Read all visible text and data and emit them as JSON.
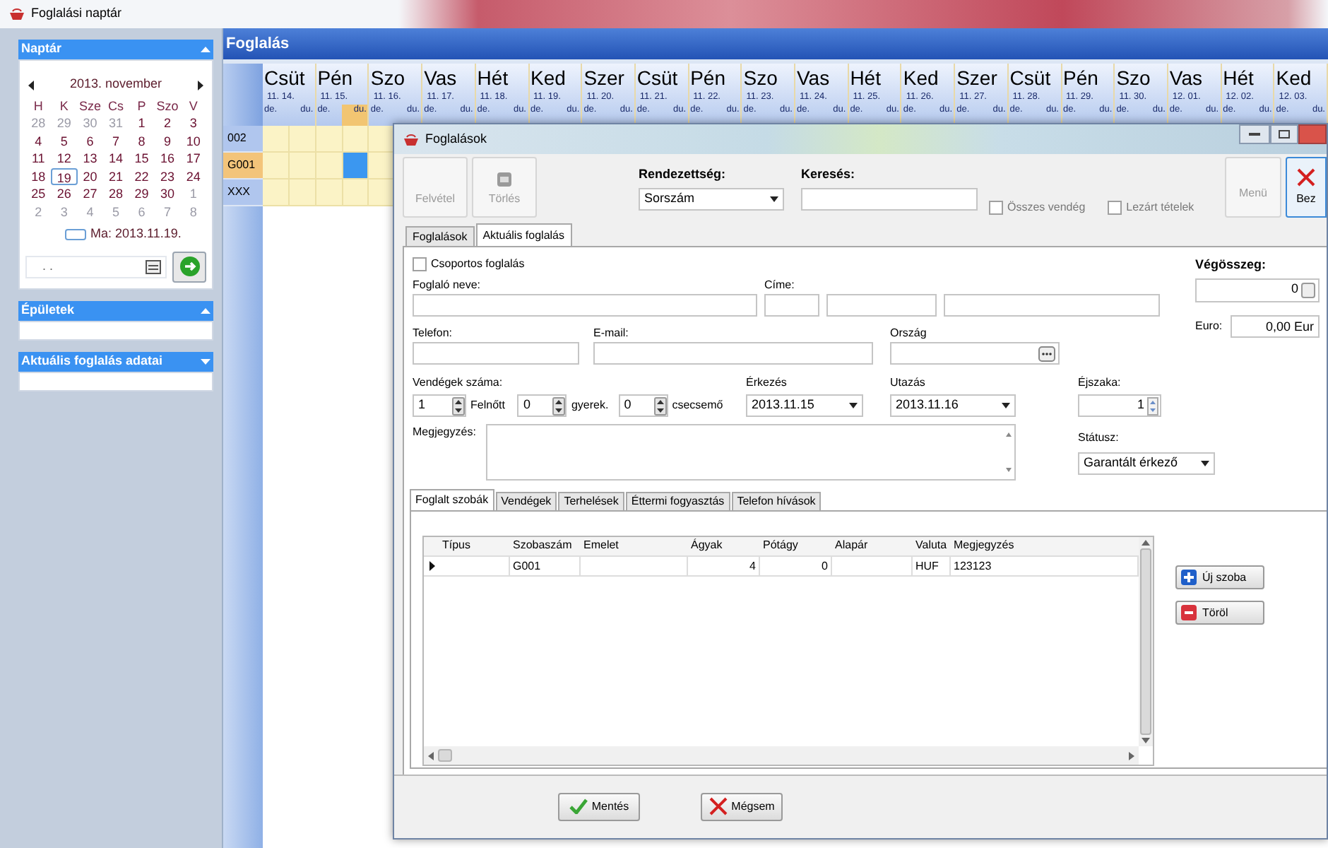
{
  "window": {
    "title": "Foglalási naptár"
  },
  "sidebar": {
    "panels": [
      {
        "kind": "calendar",
        "title": "Naptár",
        "expanded": true
      },
      {
        "kind": "empty",
        "title": "Épületek",
        "expanded": true
      },
      {
        "kind": "empty",
        "title": "Aktuális foglalás adatai",
        "expanded": false
      }
    ]
  },
  "calendar": {
    "month": "2013. november",
    "weekdays": [
      "H",
      "K",
      "Sze",
      "Cs",
      "P",
      "Szo",
      "V"
    ],
    "weeks": [
      [
        {
          "day": "28",
          "other_month": true,
          "selected": false
        },
        {
          "day": "29",
          "other_month": true,
          "selected": false
        },
        {
          "day": "30",
          "other_month": true,
          "selected": false
        },
        {
          "day": "31",
          "other_month": true,
          "selected": false
        },
        {
          "day": "1",
          "other_month": false,
          "selected": false
        },
        {
          "day": "2",
          "other_month": false,
          "selected": false
        },
        {
          "day": "3",
          "other_month": false,
          "selected": false
        }
      ],
      [
        {
          "day": "4",
          "other_month": false,
          "selected": false
        },
        {
          "day": "5",
          "other_month": false,
          "selected": false
        },
        {
          "day": "6",
          "other_month": false,
          "selected": false
        },
        {
          "day": "7",
          "other_month": false,
          "selected": false
        },
        {
          "day": "8",
          "other_month": false,
          "selected": false
        },
        {
          "day": "9",
          "other_month": false,
          "selected": false
        },
        {
          "day": "10",
          "other_month": false,
          "selected": false
        }
      ],
      [
        {
          "day": "11",
          "other_month": false,
          "selected": false
        },
        {
          "day": "12",
          "other_month": false,
          "selected": false
        },
        {
          "day": "13",
          "other_month": false,
          "selected": false
        },
        {
          "day": "14",
          "other_month": false,
          "selected": false
        },
        {
          "day": "15",
          "other_month": false,
          "selected": false
        },
        {
          "day": "16",
          "other_month": false,
          "selected": false
        },
        {
          "day": "17",
          "other_month": false,
          "selected": false
        }
      ],
      [
        {
          "day": "18",
          "other_month": false,
          "selected": false
        },
        {
          "day": "19",
          "other_month": false,
          "selected": true
        },
        {
          "day": "20",
          "other_month": false,
          "selected": false
        },
        {
          "day": "21",
          "other_month": false,
          "selected": false
        },
        {
          "day": "22",
          "other_month": false,
          "selected": false
        },
        {
          "day": "23",
          "other_month": false,
          "selected": false
        },
        {
          "day": "24",
          "other_month": false,
          "selected": false
        }
      ],
      [
        {
          "day": "25",
          "other_month": false,
          "selected": false
        },
        {
          "day": "26",
          "other_month": false,
          "selected": false
        },
        {
          "day": "27",
          "other_month": false,
          "selected": false
        },
        {
          "day": "28",
          "other_month": false,
          "selected": false
        },
        {
          "day": "29",
          "other_month": false,
          "selected": false
        },
        {
          "day": "30",
          "other_month": false,
          "selected": false
        },
        {
          "day": "1",
          "other_month": true,
          "selected": false
        }
      ],
      [
        {
          "day": "2",
          "other_month": true,
          "selected": false
        },
        {
          "day": "3",
          "other_month": true,
          "selected": false
        },
        {
          "day": "4",
          "other_month": true,
          "selected": false
        },
        {
          "day": "5",
          "other_month": true,
          "selected": false
        },
        {
          "day": "6",
          "other_month": true,
          "selected": false
        },
        {
          "day": "7",
          "other_month": true,
          "selected": false
        },
        {
          "day": "8",
          "other_month": true,
          "selected": false
        }
      ]
    ],
    "today": "Ma: 2013.11.19.",
    "date_field": {
      "value": ". ."
    }
  },
  "booking": {
    "title": "Foglalás",
    "days": [
      {
        "name": "Csüt",
        "date": "11. 14.",
        "am": "de.",
        "pm": "du.",
        "today": false
      },
      {
        "name": "Pén",
        "date": "11. 15.",
        "am": "de.",
        "pm": "du.",
        "today": true
      },
      {
        "name": "Szo",
        "date": "11. 16.",
        "am": "de.",
        "pm": "du.",
        "today": false
      },
      {
        "name": "Vas",
        "date": "11. 17.",
        "am": "de.",
        "pm": "du.",
        "today": false
      },
      {
        "name": "Hét",
        "date": "11. 18.",
        "am": "de.",
        "pm": "du.",
        "today": false
      },
      {
        "name": "Ked",
        "date": "11. 19.",
        "am": "de.",
        "pm": "du.",
        "today": false
      },
      {
        "name": "Szer",
        "date": "11. 20.",
        "am": "de.",
        "pm": "du.",
        "today": false
      },
      {
        "name": "Csüt",
        "date": "11. 21.",
        "am": "de.",
        "pm": "du.",
        "today": false
      },
      {
        "name": "Pén",
        "date": "11. 22.",
        "am": "de.",
        "pm": "du.",
        "today": false
      },
      {
        "name": "Szo",
        "date": "11. 23.",
        "am": "de.",
        "pm": "du.",
        "today": false
      },
      {
        "name": "Vas",
        "date": "11. 24.",
        "am": "de.",
        "pm": "du.",
        "today": false
      },
      {
        "name": "Hét",
        "date": "11. 25.",
        "am": "de.",
        "pm": "du.",
        "today": false
      },
      {
        "name": "Ked",
        "date": "11. 26.",
        "am": "de.",
        "pm": "du.",
        "today": false
      },
      {
        "name": "Szer",
        "date": "11. 27.",
        "am": "de.",
        "pm": "du.",
        "today": false
      },
      {
        "name": "Csüt",
        "date": "11. 28.",
        "am": "de.",
        "pm": "du.",
        "today": false
      },
      {
        "name": "Pén",
        "date": "11. 29.",
        "am": "de.",
        "pm": "du.",
        "today": false
      },
      {
        "name": "Szo",
        "date": "11. 30.",
        "am": "de.",
        "pm": "du.",
        "today": false
      },
      {
        "name": "Vas",
        "date": "12. 01.",
        "am": "de.",
        "pm": "du.",
        "today": false
      },
      {
        "name": "Hét",
        "date": "12. 02.",
        "am": "de.",
        "pm": "du.",
        "today": false
      },
      {
        "name": "Ked",
        "date": "12. 03.",
        "am": "de.",
        "pm": "du.",
        "today": false
      }
    ],
    "rooms": [
      {
        "label": "002",
        "selected": false,
        "cells": [
          {
            "booked": false
          },
          {
            "booked": false
          },
          {
            "booked": false
          },
          {
            "booked": false
          },
          {
            "booked": false
          }
        ]
      },
      {
        "label": "G001",
        "selected": true,
        "cells": [
          {
            "booked": false
          },
          {
            "booked": false
          },
          {
            "booked": false
          },
          {
            "booked": true
          },
          {
            "booked": false
          }
        ]
      },
      {
        "label": "XXX",
        "selected": false,
        "cells": [
          {
            "booked": false
          },
          {
            "booked": false
          },
          {
            "booked": false
          },
          {
            "booked": false
          },
          {
            "booked": false
          }
        ]
      }
    ]
  },
  "dialog": {
    "title": "Foglalások",
    "toolbar": {
      "buttons": [
        {
          "kind": "add",
          "label": "Felvétel",
          "disabled": true
        },
        {
          "kind": "delete",
          "label": "Törlés",
          "disabled": true
        }
      ],
      "sort": {
        "label": "Rendezettség:",
        "value": "Sorszám"
      },
      "search": {
        "label": "Keresés:"
      },
      "checkboxes": [
        {
          "label": "Összes vendég",
          "checked": false
        },
        {
          "label": "Lezárt tételek",
          "checked": false
        }
      ],
      "menu_button": {
        "label": "Menü",
        "disabled": true
      },
      "close_button": {
        "label": "Bez",
        "disabled": false
      }
    },
    "tabs": [
      {
        "label": "Foglalások",
        "selected": false
      },
      {
        "label": "Aktuális foglalás",
        "selected": true
      }
    ],
    "form": {
      "group_booking": {
        "label": "Csoportos foglalás",
        "checked": false
      },
      "name": {
        "label": "Foglaló neve:"
      },
      "address": {
        "label": "Címe:"
      },
      "phone": {
        "label": "Telefon:"
      },
      "email": {
        "label": "E-mail:"
      },
      "country": {
        "label": "Ország"
      },
      "guests": {
        "label": "Vendégek száma:",
        "adults": {
          "value": "1",
          "label": "Felnőtt"
        },
        "children": {
          "value": "0",
          "label": "gyerek."
        },
        "infants": {
          "value": "0",
          "label": "csecsemő"
        }
      },
      "arrival": {
        "label": "Érkezés",
        "value": "2013.11.15"
      },
      "departure": {
        "label": "Utazás",
        "value": "2013.11.16"
      },
      "nights": {
        "label": "Éjszaka:",
        "value": "1"
      },
      "note": {
        "label": "Megjegyzés:"
      },
      "status": {
        "label": "Státusz:",
        "value": "Garantált érkező"
      },
      "total": {
        "label": "Végösszeg:",
        "value": "0"
      },
      "euro": {
        "label": "Euro:",
        "value": "0,00 Eur"
      }
    },
    "subtabs": [
      {
        "label": "Foglalt szobák",
        "selected": true
      },
      {
        "label": "Vendégek",
        "selected": false
      },
      {
        "label": "Terhelések",
        "selected": false
      },
      {
        "label": "Éttermi fogyasztás",
        "selected": false
      },
      {
        "label": "Telefon hívások",
        "selected": false
      }
    ],
    "rooms_table": {
      "columns": [
        "Típus",
        "Szobaszám",
        "Emelet",
        "Ágyak",
        "Pótágy",
        "Alapár",
        "Valuta",
        "Megjegyzés"
      ],
      "rows": [
        {
          "current": true,
          "room_number": "G001",
          "beds": "4",
          "extra_beds": "0",
          "currency": "HUF",
          "note": "123123"
        }
      ]
    },
    "side_buttons": [
      {
        "kind": "add",
        "label": "Új szoba"
      },
      {
        "kind": "delete",
        "label": "Töröl"
      }
    ],
    "footer_buttons": [
      {
        "kind": "save",
        "label": "Mentés"
      },
      {
        "kind": "cancel",
        "label": "Mégsem"
      }
    ]
  }
}
